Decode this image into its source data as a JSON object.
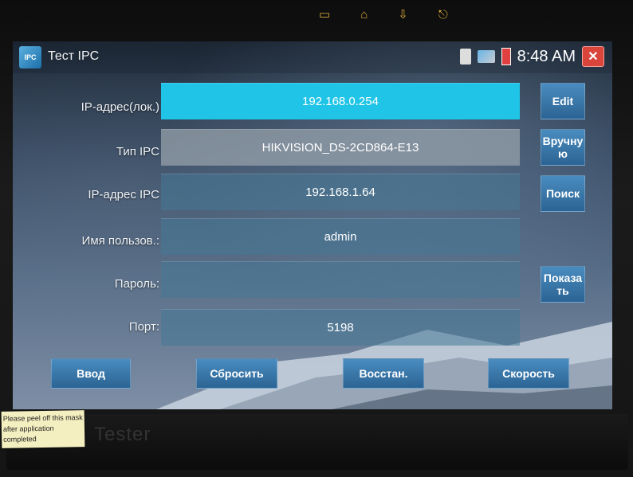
{
  "window": {
    "title": "Тест IPC",
    "time": "8:48 AM",
    "app_icon_text": "IPC"
  },
  "hardware_nav": {
    "icons": [
      "menu-icon",
      "home-icon",
      "back-icon",
      "power-icon"
    ]
  },
  "form": {
    "rows": [
      {
        "label": "IP-адрес(лок.)",
        "value": "192.168.0.254",
        "button": "Edit"
      },
      {
        "label": "Тип IPC",
        "value": "HIKVISION_DS-2CD864-E13",
        "button": "Вручну ю"
      },
      {
        "label": "IP-адрес IPC",
        "value": "192.168.1.64",
        "button": "Поиск"
      },
      {
        "label": "Имя пользов.:",
        "value": "admin",
        "button": ""
      },
      {
        "label": "Пароль:",
        "value": "",
        "button": "Показа ть"
      },
      {
        "label": "Порт:",
        "value": "5198",
        "button": ""
      }
    ]
  },
  "actions": {
    "enter": "Ввод",
    "reset": "Сбросить",
    "restore": "Восстан.",
    "speed": "Скорость"
  },
  "device": {
    "brand": "Tester",
    "sticker": "Please peel off this mask after application completed"
  },
  "colors": {
    "active_field": "#1fc4e6",
    "button": "#2b6494",
    "close": "#d9443b"
  }
}
